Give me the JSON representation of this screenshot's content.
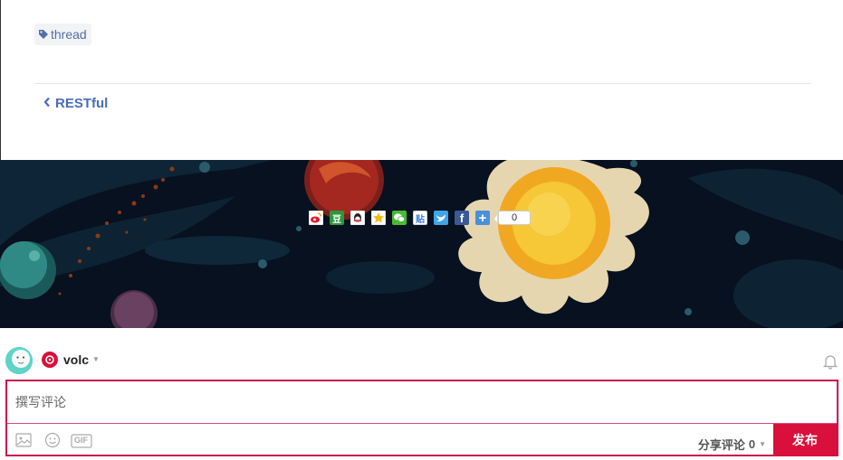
{
  "article": {
    "tag_label": "thread",
    "prev_link_label": "RESTful"
  },
  "share": {
    "buttons": [
      {
        "name": "weibo",
        "glyph": "",
        "color": "#e6162d"
      },
      {
        "name": "douban",
        "glyph": "豆",
        "color": "#2e963d"
      },
      {
        "name": "qq",
        "glyph": "",
        "color": "#1a8fe3"
      },
      {
        "name": "qzone",
        "glyph": "",
        "color": "#f5b90b"
      },
      {
        "name": "wechat",
        "glyph": "",
        "color": "#46bb36"
      },
      {
        "name": "tieba",
        "glyph": "贴",
        "color": "#3a7edb"
      },
      {
        "name": "twitter",
        "glyph": "",
        "color": "#3fa4e8"
      },
      {
        "name": "facebook",
        "glyph": "f",
        "color": "#3b5998"
      },
      {
        "name": "more",
        "glyph": "+",
        "color": "#4a90d9"
      }
    ],
    "count": "0"
  },
  "comment": {
    "username": "volc",
    "placeholder": "撰写评论",
    "share_comment_label": "分享评论",
    "share_comment_count": "0",
    "publish_label": "发布",
    "toolbar_icons": [
      "image-icon",
      "emoji-icon",
      "gif-icon"
    ],
    "gif_label": "GIF"
  },
  "colors": {
    "accent": "#d8103b",
    "link": "#4b6cb7",
    "banner_bg": "#081322"
  }
}
